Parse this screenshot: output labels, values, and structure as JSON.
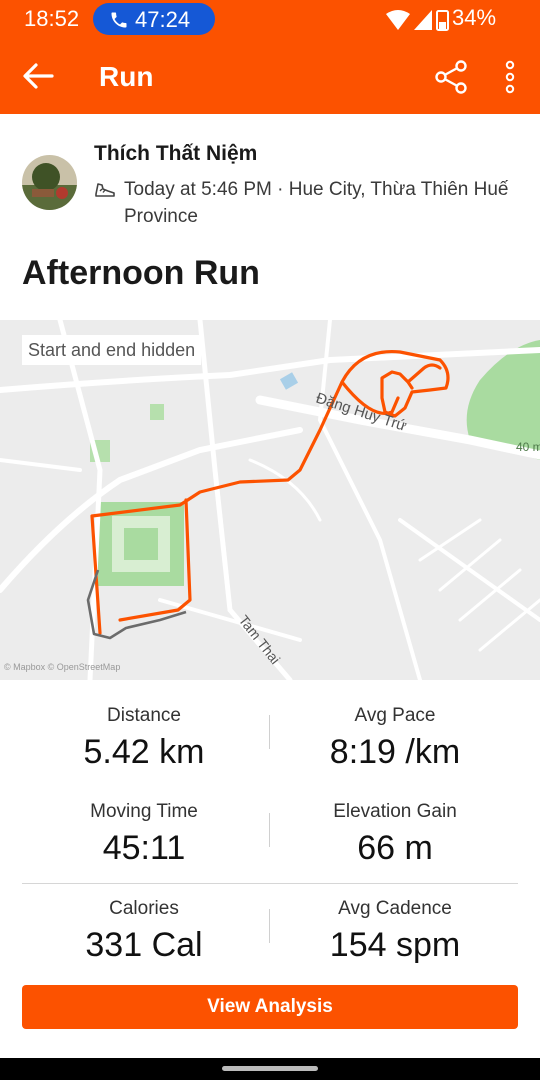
{
  "status_bar": {
    "time": "18:52",
    "call_timer": "47:24",
    "battery": "34%",
    "icons": [
      "phone-icon",
      "wifi-icon",
      "signal-icon",
      "battery-icon"
    ]
  },
  "app_bar": {
    "title": "Run",
    "icons": [
      "back-arrow-icon",
      "share-icon",
      "more-vert-icon"
    ]
  },
  "athlete": {
    "name": "Thích Thất Niệm",
    "meta": "Today at 5:46 PM · Hue City, Thừa Thiên Huế Province"
  },
  "activity": {
    "title": "Afternoon Run"
  },
  "map": {
    "badge": "Start and end hidden",
    "labels": {
      "street_1": "Đặng Huy Trứ",
      "street_2": "Tam Thai",
      "elevation": "40 m"
    },
    "attribution": "© Mapbox © OpenStreetMap",
    "route_color": "#fc5200",
    "hidden_route_color": "#6b6b6b"
  },
  "stats": {
    "distance": {
      "label": "Distance",
      "value": "5.42 km"
    },
    "avg_pace": {
      "label": "Avg Pace",
      "value": "8:19 /km"
    },
    "moving_time": {
      "label": "Moving Time",
      "value": "45:11"
    },
    "elevation_gain": {
      "label": "Elevation Gain",
      "value": "66 m"
    },
    "calories": {
      "label": "Calories",
      "value": "331 Cal"
    },
    "avg_cadence": {
      "label": "Avg Cadence",
      "value": "154 spm"
    }
  },
  "actions": {
    "view_analysis": "View Analysis"
  },
  "colors": {
    "brand": "#fc5200",
    "call_pill": "#1558d6"
  }
}
